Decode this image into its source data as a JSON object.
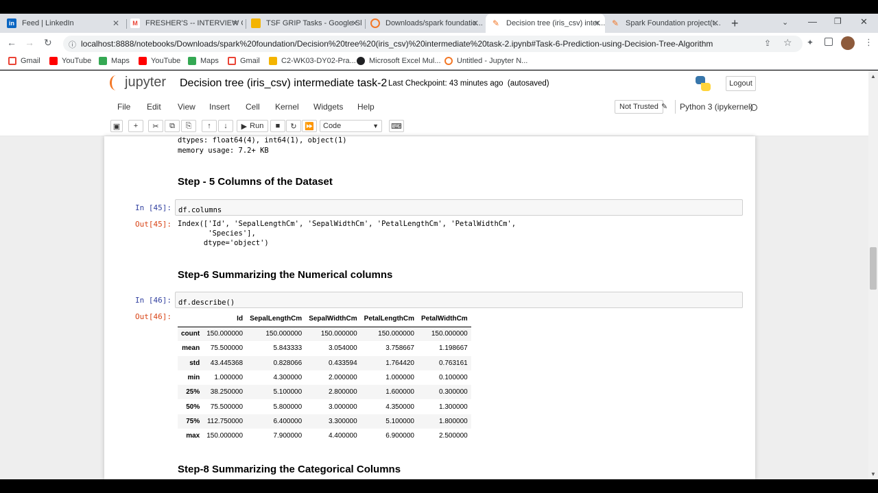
{
  "browser": {
    "tabs": [
      {
        "label": "Feed | LinkedIn",
        "icon": "linkedin-icon",
        "color": "#0a66c2"
      },
      {
        "label": "FRESHER'S -- INTERVIEW C...",
        "icon": "gmail-icon",
        "color": "#ea4335"
      },
      {
        "label": "TSF GRIP Tasks - Google Sli...",
        "icon": "slides-icon",
        "color": "#f4b400"
      },
      {
        "label": "Downloads/spark foundatio...",
        "icon": "jupyter-icon",
        "color": "#f37726"
      },
      {
        "label": "Decision tree (iris_csv) inter...",
        "icon": "jupyter-icon",
        "color": "#f37726"
      },
      {
        "label": "Spark Foundation project(t...",
        "icon": "jupyter-icon",
        "color": "#f37726"
      }
    ],
    "url": "localhost:8888/notebooks/Downloads/spark%20foundation/Decision%20tree%20(iris_csv)%20intermediate%20task-2.ipynb#Task-6-Prediction-using-Decision-Tree-Algorithm",
    "bookmarks": [
      {
        "label": "Gmail",
        "color": "#ea4335"
      },
      {
        "label": "YouTube",
        "color": "#ff0000"
      },
      {
        "label": "Maps",
        "color": "#34a853"
      },
      {
        "label": "YouTube",
        "color": "#ff0000"
      },
      {
        "label": "Maps",
        "color": "#34a853"
      },
      {
        "label": "Gmail",
        "color": "#ea4335"
      },
      {
        "label": "C2-WK03-DY02-Pra...",
        "color": "#f4b400"
      },
      {
        "label": "Microsoft Excel Mul...",
        "color": "#202124"
      },
      {
        "label": "Untitled - Jupyter N...",
        "color": "#f37726"
      }
    ]
  },
  "jupyter": {
    "logo_text": "jupyter",
    "notebook_title": "Decision tree (iris_csv) intermediate task-2",
    "checkpoint_label": "Last Checkpoint:",
    "checkpoint_time": "43 minutes ago",
    "autosaved": "(autosaved)",
    "logout": "Logout",
    "menu": [
      "File",
      "Edit",
      "View",
      "Insert",
      "Cell",
      "Kernel",
      "Widgets",
      "Help"
    ],
    "not_trusted": "Not Trusted",
    "kernel": "Python 3 (ipykernel)",
    "run_label": "Run",
    "cell_type": "Code"
  },
  "notebook": {
    "info_lines": [
      "dtypes: float64(4), int64(1), object(1)",
      "memory usage: 7.2+ KB"
    ],
    "heading5": "Step - 5 Columns of the Dataset",
    "in45_prompt": "In [45]:",
    "in45_code": "df.columns",
    "out45_prompt": "Out[45]:",
    "out45_lines": [
      "Index(['Id', 'SepalLengthCm', 'SepalWidthCm', 'PetalLengthCm', 'PetalWidthCm',",
      "       'Species'],",
      "      dtype='object')"
    ],
    "heading6": "Step-6 Summarizing the Numerical columns",
    "in46_prompt": "In [46]:",
    "in46_code": "df.describe()",
    "out46_prompt": "Out[46]:",
    "describe": {
      "columns": [
        "Id",
        "SepalLengthCm",
        "SepalWidthCm",
        "PetalLengthCm",
        "PetalWidthCm"
      ],
      "rows": [
        {
          "index": "count",
          "values": [
            "150.000000",
            "150.000000",
            "150.000000",
            "150.000000",
            "150.000000"
          ]
        },
        {
          "index": "mean",
          "values": [
            "75.500000",
            "5.843333",
            "3.054000",
            "3.758667",
            "1.198667"
          ]
        },
        {
          "index": "std",
          "values": [
            "43.445368",
            "0.828066",
            "0.433594",
            "1.764420",
            "0.763161"
          ]
        },
        {
          "index": "min",
          "values": [
            "1.000000",
            "4.300000",
            "2.000000",
            "1.000000",
            "0.100000"
          ]
        },
        {
          "index": "25%",
          "values": [
            "38.250000",
            "5.100000",
            "2.800000",
            "1.600000",
            "0.300000"
          ]
        },
        {
          "index": "50%",
          "values": [
            "75.500000",
            "5.800000",
            "3.000000",
            "4.350000",
            "1.300000"
          ]
        },
        {
          "index": "75%",
          "values": [
            "112.750000",
            "6.400000",
            "3.300000",
            "5.100000",
            "1.800000"
          ]
        },
        {
          "index": "max",
          "values": [
            "150.000000",
            "7.900000",
            "4.400000",
            "6.900000",
            "2.500000"
          ]
        }
      ]
    },
    "heading8": "Step-8 Summarizing the Categorical Columns"
  }
}
